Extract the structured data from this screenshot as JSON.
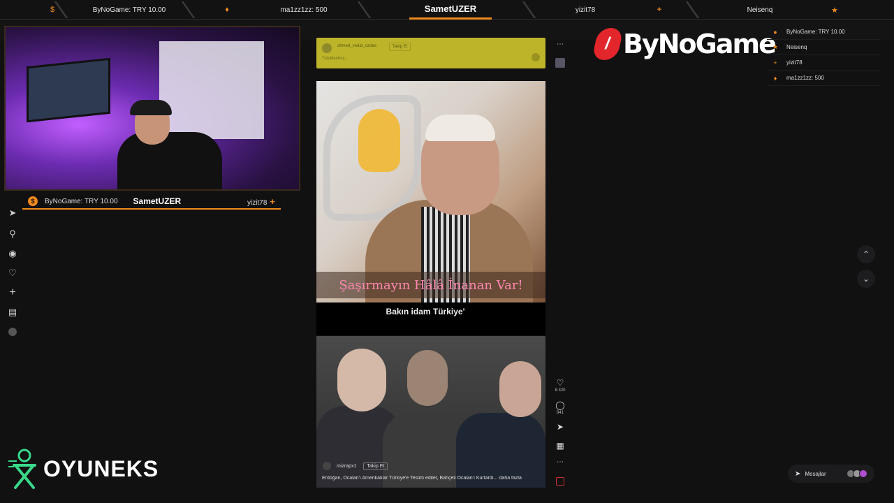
{
  "top_bar": {
    "segments": [
      "ByNoGame: TRY 10.00",
      "ma1zz1zz: 500",
      "SametUZER",
      "yizit78",
      "Neisenq"
    ],
    "accent": "#f08a1c"
  },
  "webcam_bar": {
    "donation": "ByNoGame: TRY 10.00",
    "streamer": "SametUZER",
    "recent": "yizit78"
  },
  "left_nav": [
    "send-icon",
    "search-icon",
    "compass-icon",
    "heart-icon",
    "plus-icon",
    "chart-icon",
    "avatar"
  ],
  "post_top": {
    "username": "ahmed_vedat_ozdee",
    "follow": "Takip Et",
    "caption": "Tutuklanmış..."
  },
  "video1": {
    "caption": "Şaşırmayın Hâlâ İnanan Var!"
  },
  "gap_text": "Bakın idam Türkiye'",
  "post2": {
    "username": "mizrapx1",
    "follow": "Takip Et",
    "caption": "Erdoğan, Öcalan'ı Amerikalılar Türkiye'e Teslim ediler, Bahçeli Öcalan'ı Kurtardı... daha fazla"
  },
  "actions": {
    "likes": "8.320",
    "comments": "841"
  },
  "brand": {
    "name": "ByNoGame",
    "color": "#e3262b"
  },
  "donors": [
    {
      "icon": "coin",
      "text": "ByNoGame: TRY 10.00"
    },
    {
      "icon": "star",
      "text": "Neisenq"
    },
    {
      "icon": "plus",
      "text": "yizit78"
    },
    {
      "icon": "flame",
      "text": "ma1zz1zz: 500"
    }
  ],
  "messages": {
    "label": "Mesajlar"
  },
  "sponsor": "OYUNEKS"
}
